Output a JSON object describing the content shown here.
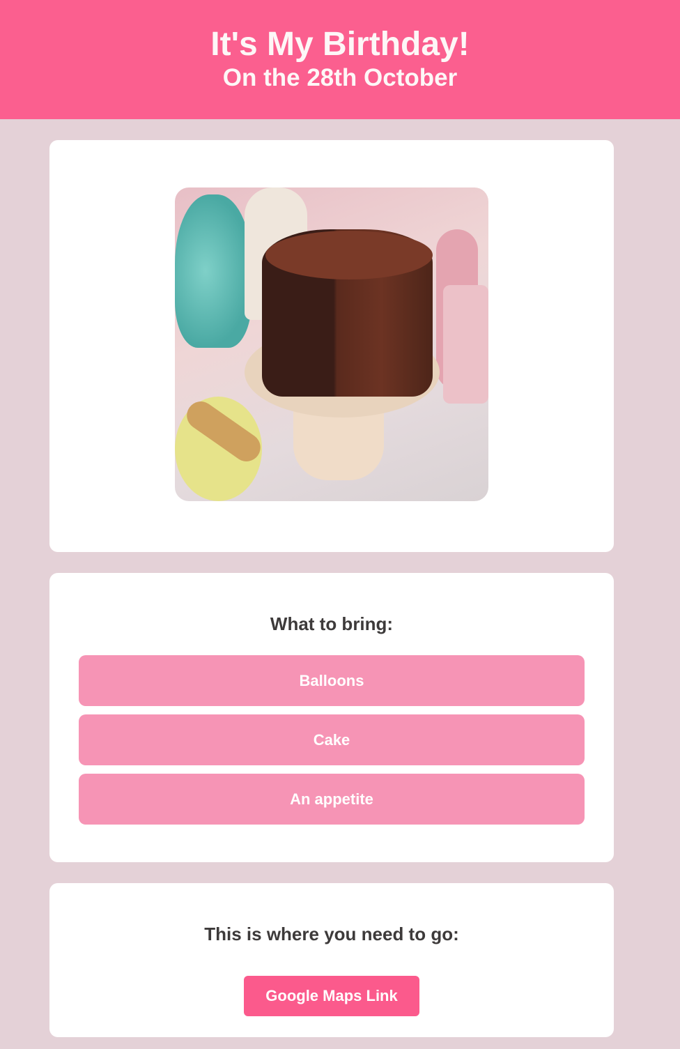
{
  "header": {
    "title": "It's My Birthday!",
    "subtitle": "On the 28th October"
  },
  "photo": {
    "alt": "Chocolate cake"
  },
  "bring": {
    "heading": "What to bring:",
    "items": [
      {
        "label": "Balloons"
      },
      {
        "label": "Cake"
      },
      {
        "label": "An appetite"
      }
    ]
  },
  "location": {
    "heading": "This is where you need to go:",
    "link_label": "Google Maps Link"
  },
  "colors": {
    "header": "#fb5f8f",
    "background": "#e4d1d7",
    "item_button": "#f694b5",
    "maps_button": "#fb5a8c"
  }
}
